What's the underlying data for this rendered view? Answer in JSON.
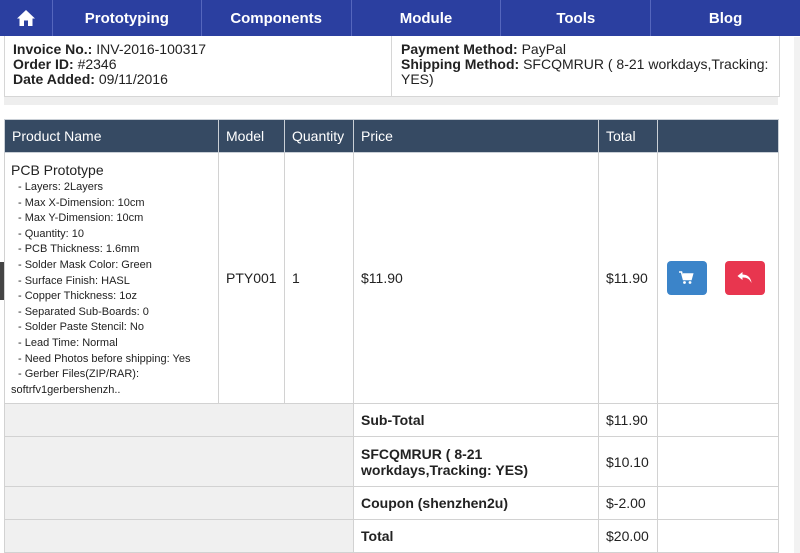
{
  "nav": {
    "home_icon": "home-icon",
    "items": [
      "Prototyping",
      "Components",
      "Module",
      "Tools",
      "Blog"
    ]
  },
  "info": {
    "invoice_label": "Invoice No.:",
    "invoice_value": "INV-2016-100317",
    "order_label": "Order ID:",
    "order_value": "#2346",
    "date_label": "Date Added:",
    "date_value": "09/11/2016",
    "payment_label": "Payment Method:",
    "payment_value": "PayPal",
    "shipping_label": "Shipping Method:",
    "shipping_value": "SFCQMRUR ( 8-21 workdays,Tracking: YES)"
  },
  "table": {
    "headers": [
      "Product Name",
      "Model",
      "Quantity",
      "Price",
      "Total"
    ],
    "product": {
      "name": "PCB Prototype",
      "options": [
        "- Layers: 2Layers",
        "- Max X-Dimension: 10cm",
        "- Max Y-Dimension: 10cm",
        "- Quantity: 10",
        "- PCB Thickness: 1.6mm",
        "- Solder Mask Color: Green",
        "- Surface Finish: HASL",
        "- Copper Thickness: 1oz",
        "- Separated Sub-Boards: 0",
        "- Solder Paste Stencil: No",
        "- Lead Time: Normal",
        "- Need Photos before shipping: Yes",
        "- Gerber Files(ZIP/RAR):"
      ],
      "gerber_file": "softrfv1gerbershenzh..",
      "model": "PTY001",
      "quantity": "1",
      "price": "$11.90",
      "total": "$11.90"
    },
    "totals": [
      {
        "label": "Sub-Total",
        "value": "$11.90"
      },
      {
        "label": "SFCQMRUR ( 8-21 workdays,Tracking: YES)",
        "value": "$10.10"
      },
      {
        "label": "Coupon (shenzhen2u)",
        "value": "$-2.00"
      },
      {
        "label": "Total",
        "value": "$20.00"
      }
    ]
  },
  "colors": {
    "nav_bg": "#2b3fa0",
    "table_header_bg": "#364a63",
    "reorder_button": "#3b84c9",
    "return_button": "#e8364f"
  },
  "icons": {
    "reorder": "cart-icon",
    "return": "return-arrow-icon"
  }
}
